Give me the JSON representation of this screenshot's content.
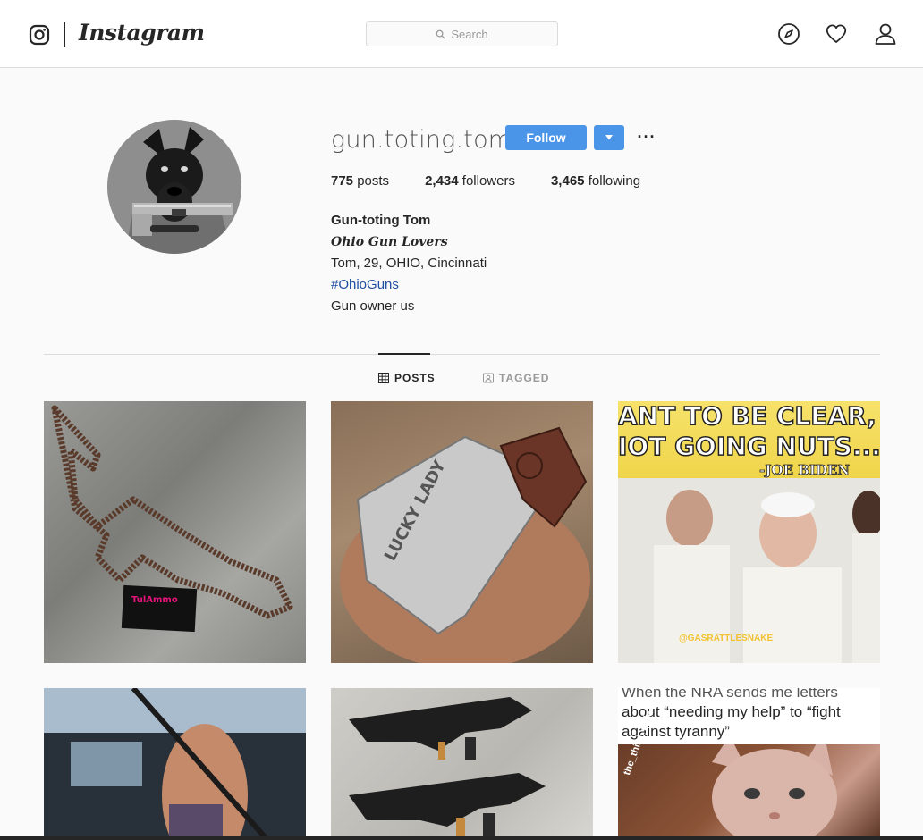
{
  "header": {
    "wordmark": "Instagram",
    "search_placeholder": "Search"
  },
  "profile": {
    "username": "gun.toting.tom",
    "follow_label": "Follow",
    "more_label": "···",
    "stats": [
      {
        "count": "775",
        "label": "posts"
      },
      {
        "count": "2,434",
        "label": "followers"
      },
      {
        "count": "3,465",
        "label": "following"
      }
    ],
    "bio": {
      "name": "Gun-toting Tom",
      "subtitle": "Ohio Gun Lovers",
      "line1": "Tom, 29, OHIO, Cincinnati",
      "hashtag": "#OhioGuns",
      "line2": "Gun owner us"
    }
  },
  "tabs": [
    {
      "label": "POSTS",
      "active": true
    },
    {
      "label": "TAGGED",
      "active": false
    }
  ],
  "posts": [
    {
      "desc": "ammo-rifle-shape",
      "box_label": "TulAmmo"
    },
    {
      "desc": "engraved-pistol",
      "engraving": "LUCKY LADY"
    },
    {
      "desc": "meme",
      "line1": "ANT TO BE CLEAR, I'",
      "line2": "IOT GOING NUTS...\"",
      "attribution": "-JOE BIDEN",
      "watermark": "@GASRATTLESNAKE"
    },
    {
      "desc": "woman-with-rifle"
    },
    {
      "desc": "two-rifles"
    },
    {
      "desc": "cat-meme",
      "caption_top": "When the NRA sends me letters",
      "caption": "about “needing my help” to “fight against tyranny”",
      "watermark": "the_third_hole"
    }
  ],
  "colors": {
    "follow_blue": "#4b95e9",
    "hashtag_blue": "#1f4ea0",
    "border": "#dbdbdb",
    "background": "#fafafa"
  }
}
